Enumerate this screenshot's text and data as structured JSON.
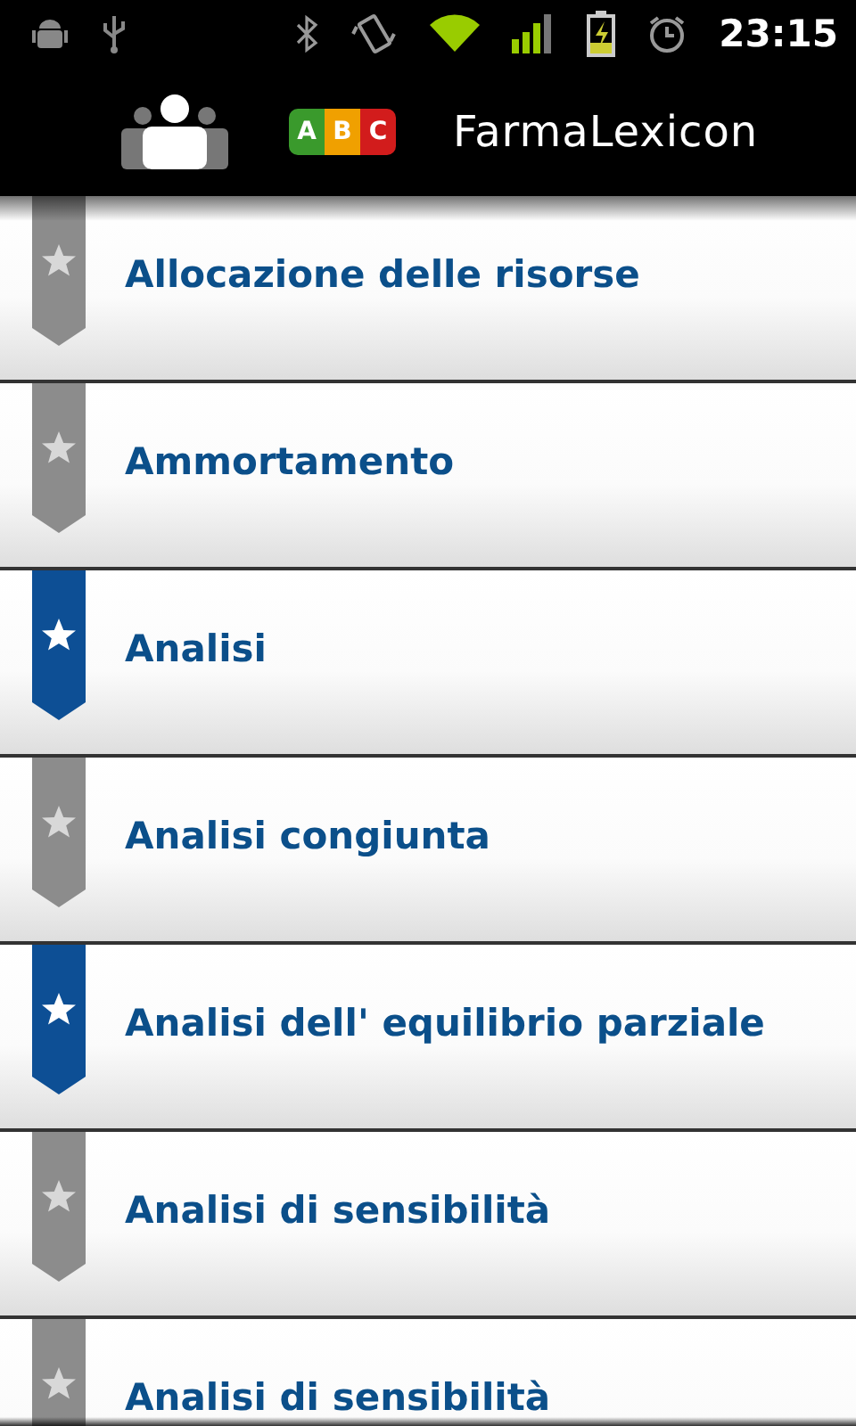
{
  "status_bar": {
    "time": "23:15"
  },
  "header": {
    "logo_letters": [
      "A",
      "B",
      "C"
    ],
    "title": "FarmaLexicon"
  },
  "terms": [
    {
      "label": "Allocazione delle risorse",
      "bookmarked": false
    },
    {
      "label": "Ammortamento",
      "bookmarked": false
    },
    {
      "label": "Analisi",
      "bookmarked": true
    },
    {
      "label": "Analisi congiunta",
      "bookmarked": false
    },
    {
      "label": "Analisi dell' equilibrio parziale",
      "bookmarked": true
    },
    {
      "label": "Analisi di sensibilità",
      "bookmarked": false
    },
    {
      "label": "Analisi di sensibilità",
      "bookmarked": false
    }
  ]
}
